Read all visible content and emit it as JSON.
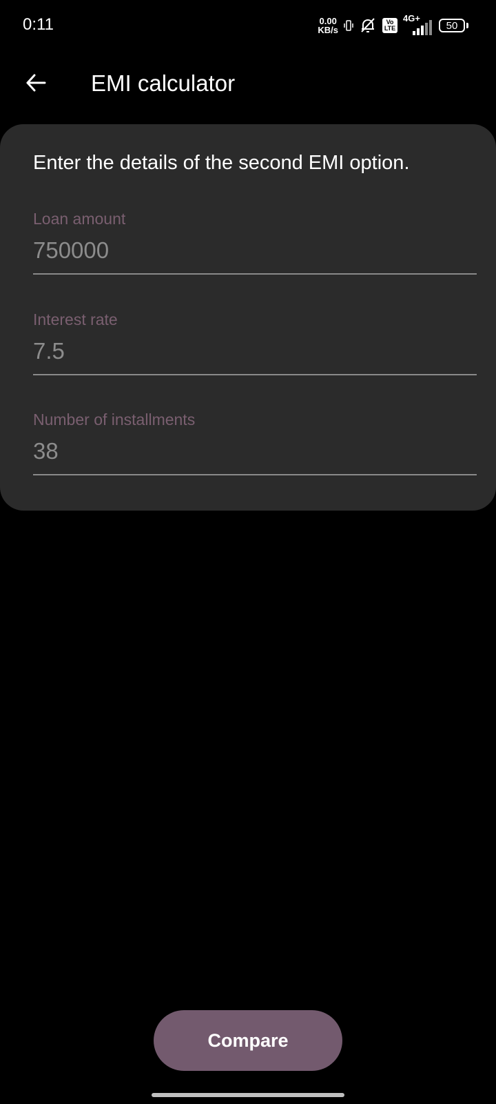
{
  "status_bar": {
    "time": "0:11",
    "net_speed_value": "0.00",
    "net_speed_unit": "KB/s",
    "volte_top": "Vo",
    "volte_bottom": "LTE",
    "network_type": "4G+",
    "battery_level": "50"
  },
  "app_bar": {
    "title": "EMI calculator"
  },
  "form": {
    "heading": "Enter the details of the second EMI option.",
    "loan_amount": {
      "label": "Loan amount",
      "value": "750000"
    },
    "interest_rate": {
      "label": "Interest rate",
      "value": "7.5"
    },
    "installments": {
      "label": "Number of installments",
      "value": "38"
    }
  },
  "actions": {
    "compare_label": "Compare"
  },
  "colors": {
    "background": "#000000",
    "card": "#2b2b2b",
    "label": "#7a5f70",
    "value": "#8c8c8c",
    "accent_button": "#735a6e"
  }
}
